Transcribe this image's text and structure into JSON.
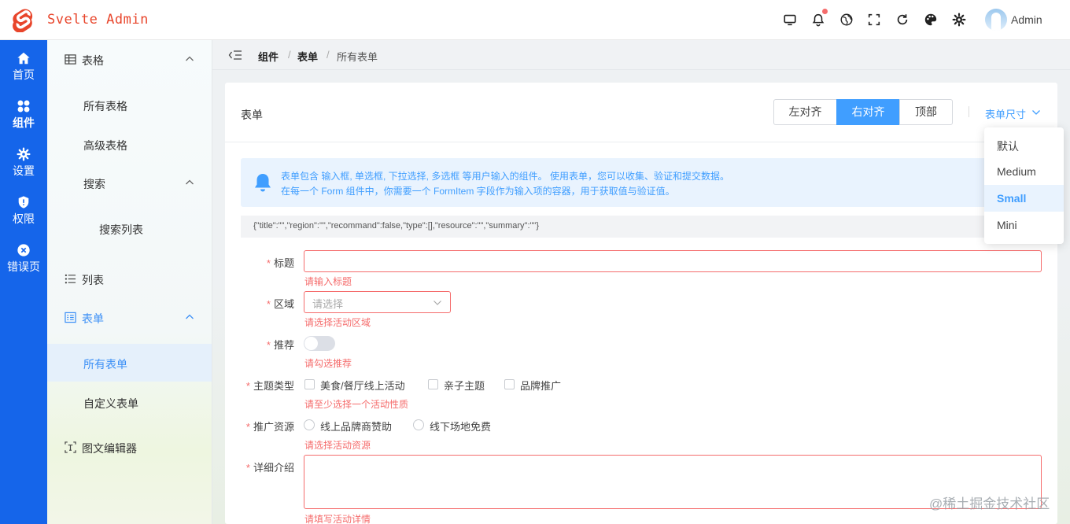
{
  "header": {
    "brand": "Svelte Admin",
    "user": "Admin",
    "icons": [
      "monitor-icon",
      "bell-icon",
      "language-icon",
      "fullscreen-icon",
      "refresh-icon",
      "palette-icon",
      "settings-icon"
    ]
  },
  "leftbar": {
    "items": [
      {
        "label": "首页",
        "icon": "home-icon"
      },
      {
        "label": "组件",
        "icon": "components-icon"
      },
      {
        "label": "设置",
        "icon": "gear-icon"
      },
      {
        "label": "权限",
        "icon": "shield-icon"
      },
      {
        "label": "错误页",
        "icon": "error-icon"
      }
    ],
    "active_index": 1
  },
  "submenu": {
    "items": [
      {
        "label": "表格",
        "icon": "table-icon"
      },
      {
        "label": "所有表格"
      },
      {
        "label": "高级表格"
      },
      {
        "label": "搜索"
      },
      {
        "label": "搜索列表"
      },
      {
        "label": "列表",
        "icon": "list-icon"
      },
      {
        "label": "表单",
        "icon": "form-icon"
      },
      {
        "label": "所有表单"
      },
      {
        "label": "自定义表单"
      },
      {
        "label": "图文编辑器",
        "icon": "editor-icon"
      }
    ],
    "active": "所有表单"
  },
  "breadcrumb": {
    "items": [
      "组件",
      "表单",
      "所有表单"
    ],
    "separator": "/"
  },
  "card": {
    "title": "表单",
    "align_buttons": [
      "左对齐",
      "右对齐",
      "顶部"
    ],
    "align_selected": "右对齐",
    "size_label": "表单尺寸",
    "size_options": [
      "默认",
      "Medium",
      "Small",
      "Mini"
    ],
    "size_selected": "Small"
  },
  "alert": {
    "line1": "表单包含 输入框, 单选框, 下拉选择, 多选框 等用户输入的组件。 使用表单，您可以收集、验证和提交数据。",
    "line2": "在每一个 Form 组件中，你需要一个 FormItem 字段作为输入项的容器，用于获取值与验证值。"
  },
  "json_preview": "{\"title\":\"\",\"region\":\"\",\"recommand\":false,\"type\":[],\"resource\":\"\",\"summary\":\"\"}",
  "form": {
    "title": {
      "label": "标题",
      "error": "请输入标题"
    },
    "region": {
      "label": "区域",
      "placeholder": "请选择",
      "error": "请选择活动区域"
    },
    "recommend": {
      "label": "推荐",
      "value": false,
      "error": "请勾选推荐"
    },
    "type": {
      "label": "主题类型",
      "options": [
        "美食/餐厅线上活动",
        "亲子主题",
        "品牌推广"
      ],
      "error": "请至少选择一个活动性质"
    },
    "resource": {
      "label": "推广资源",
      "options": [
        "线上品牌商赞助",
        "线下场地免费"
      ],
      "error": "请选择活动资源"
    },
    "summary": {
      "label": "详细介绍",
      "error": "请填写活动详情"
    }
  },
  "watermark": "@稀土掘金技术社区",
  "colors": {
    "primary": "#409eff",
    "sidebar": "#1565ea",
    "brand": "#e8452b",
    "error": "#f56c6c"
  }
}
